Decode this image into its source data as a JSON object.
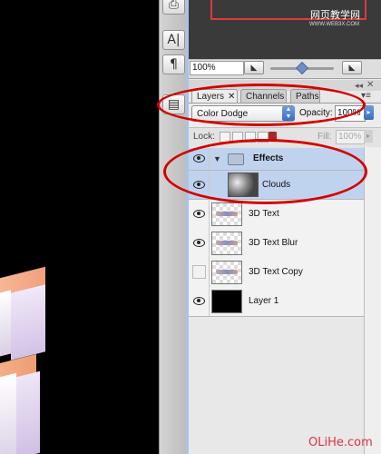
{
  "navigator": {
    "zoom_value": "100%",
    "zoom_out_label": "◣",
    "zoom_in_label": "◣"
  },
  "tools": {
    "text_tool": "A|",
    "paragraph_tool": "¶"
  },
  "layers_panel": {
    "tabs": [
      {
        "label": "Layers",
        "active": true
      },
      {
        "label": "Channels",
        "active": false
      },
      {
        "label": "Paths",
        "active": false
      }
    ],
    "tab_close": "✕",
    "blend_mode": "Color Dodge",
    "opacity_label": "Opacity:",
    "opacity_value": "100%",
    "lock_label": "Lock:",
    "fill_label": "Fill:",
    "fill_value": "100%",
    "layers": [
      {
        "name": "Effects",
        "type": "group",
        "visible": true,
        "selected": true
      },
      {
        "name": "Clouds",
        "type": "layer",
        "visible": true,
        "selected": true
      },
      {
        "name": "3D Text",
        "type": "layer",
        "visible": true,
        "selected": false
      },
      {
        "name": "3D Text Blur",
        "type": "layer",
        "visible": true,
        "selected": false
      },
      {
        "name": "3D Text Copy",
        "type": "layer",
        "visible": false,
        "selected": false
      },
      {
        "name": "Layer 1",
        "type": "layer",
        "visible": true,
        "selected": false
      }
    ]
  },
  "colors": {
    "annotation": "#d40000",
    "selection": "#bfd3ef",
    "canvas": "#000000"
  },
  "watermarks": {
    "top": "网页教学网",
    "top_sub": "WWW.WEB3X.COM",
    "bottom": "OLiHe.com"
  }
}
